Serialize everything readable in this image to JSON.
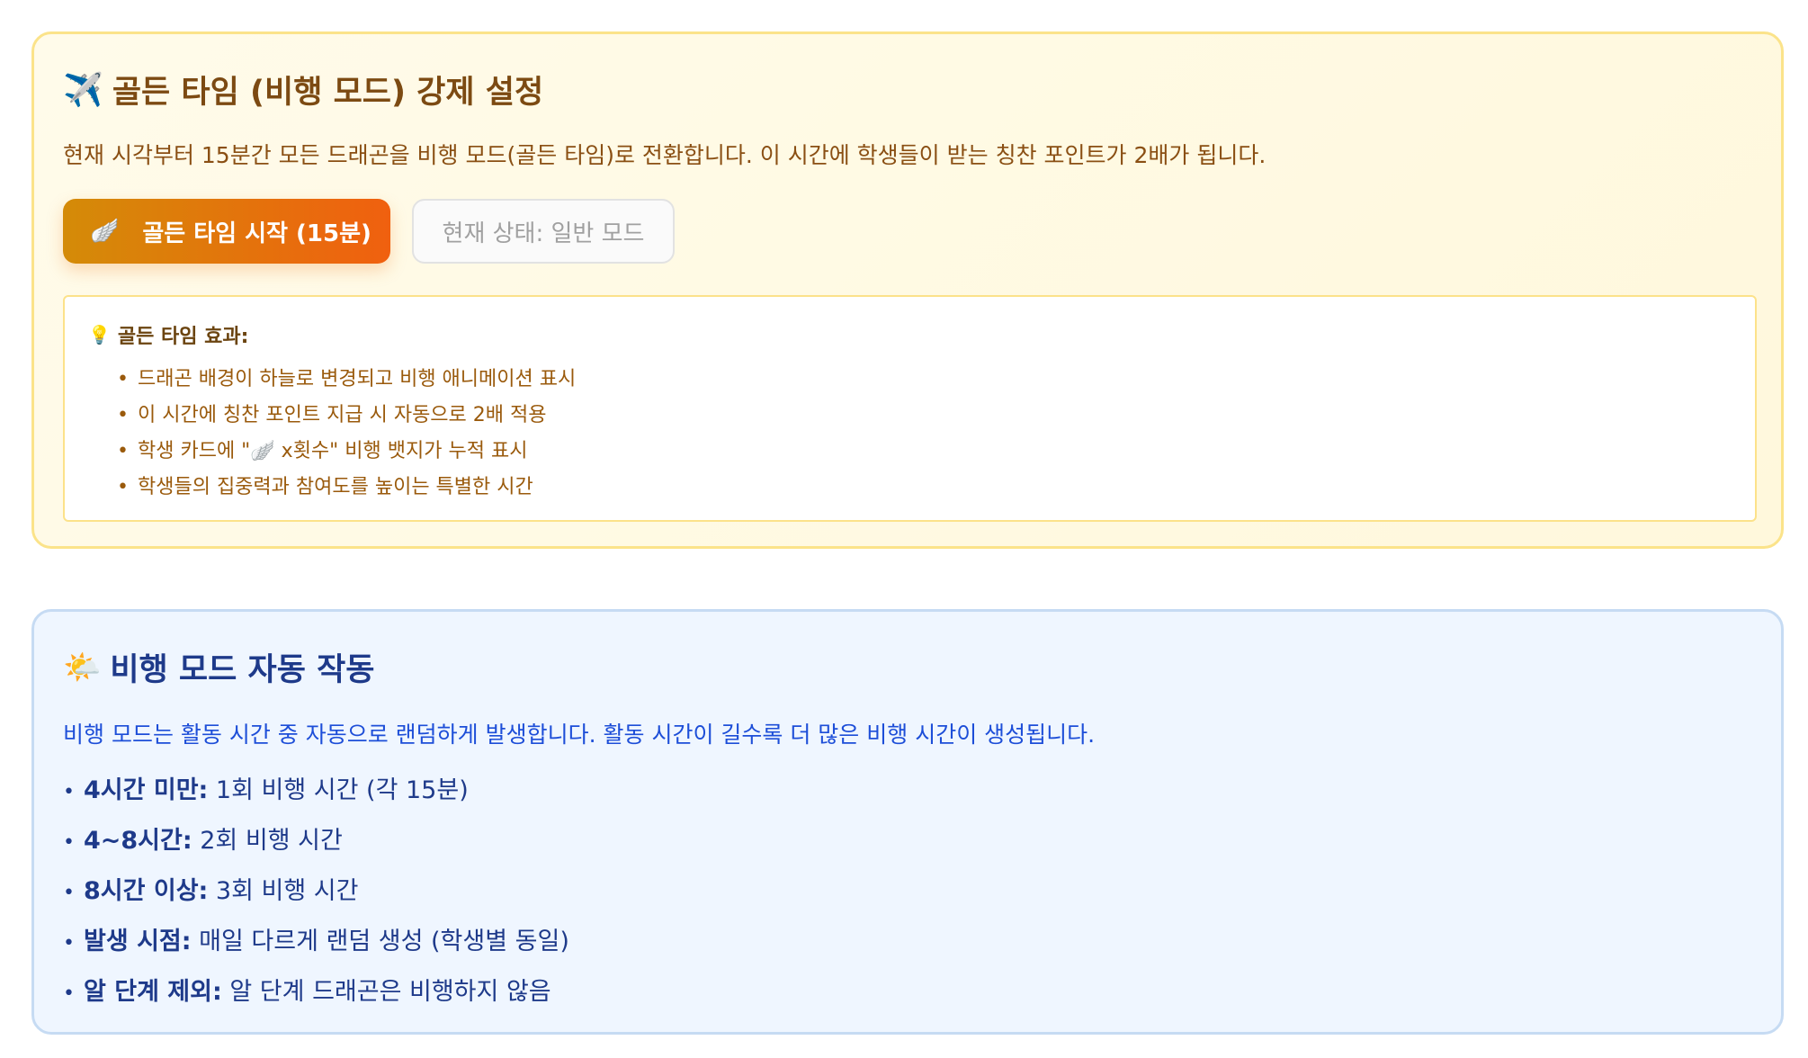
{
  "golden": {
    "icon": "airplane-icon",
    "title": "골든 타임 (비행 모드) 강제 설정",
    "description": "현재 시각부터 15분간 모든 드래곤을 비행 모드(골든 타임)로 전환합니다. 이 시간에 학생들이 받는 칭찬 포인트가 2배가 됩니다.",
    "start_button_label": "골든 타임 시작 (15분)",
    "status_label": "현재 상태: 일반 모드",
    "effects_title": "골든 타임 효과:",
    "effects": [
      "드래곤 배경이 하늘로 변경되고 비행 애니메이션 표시",
      "이 시간에 칭찬 포인트 지급 시 자동으로 2배 적용",
      "학생 카드에 \"🪽 x횟수\" 비행 뱃지가 누적 표시",
      "학생들의 집중력과 참여도를 높이는 특별한 시간"
    ],
    "colors": {
      "accent": "#f0600f",
      "border": "#fbe38a",
      "title": "#7c4a12"
    }
  },
  "auto": {
    "icon": "sun-cloud-icon",
    "title": "비행 모드 자동 작동",
    "description": "비행 모드는 활동 시간 중 자동으로 랜덤하게 발생합니다. 활동 시간이 길수록 더 많은 비행 시간이 생성됩니다.",
    "rules": [
      {
        "label": "4시간 미만:",
        "text": " 1회 비행 시간 (각 15분)"
      },
      {
        "label": "4~8시간:",
        "text": " 2회 비행 시간"
      },
      {
        "label": "8시간 이상:",
        "text": " 3회 비행 시간"
      },
      {
        "label": "발생 시점:",
        "text": " 매일 다르게 랜덤 생성 (학생별 동일)"
      },
      {
        "label": "알 단계 제외:",
        "text": " 알 단계 드래곤은 비행하지 않음"
      }
    ],
    "colors": {
      "border": "#c6dbf3",
      "background": "#eff6ff",
      "title": "#1e3a8a"
    }
  }
}
